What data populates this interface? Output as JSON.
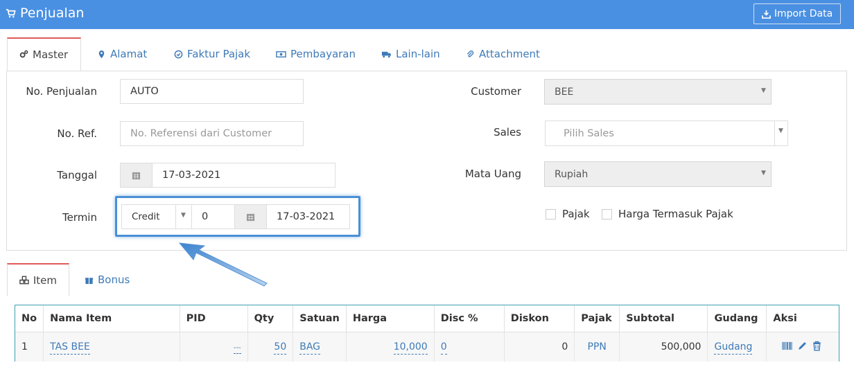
{
  "header": {
    "title": "Penjualan",
    "import_label": "Import Data",
    "bg_color": "#4a90e2"
  },
  "tabs": [
    {
      "label": "Master",
      "icon": "cogs-icon"
    },
    {
      "label": "Alamat",
      "icon": "map-marker-icon"
    },
    {
      "label": "Faktur Pajak",
      "icon": "check-circle-icon"
    },
    {
      "label": "Pembayaran",
      "icon": "money-icon"
    },
    {
      "label": "Lain-lain",
      "icon": "truck-icon"
    },
    {
      "label": "Attachment",
      "icon": "paperclip-icon"
    }
  ],
  "form": {
    "no_penjualan_label": "No. Penjualan",
    "no_penjualan_value": "AUTO",
    "no_ref_label": "No. Ref.",
    "no_ref_placeholder": "No. Referensi dari Customer",
    "tanggal_label": "Tanggal",
    "tanggal_value": "17-03-2021",
    "termin_label": "Termin",
    "termin_type": "Credit",
    "termin_days": "0",
    "termin_date": "17-03-2021",
    "customer_label": "Customer",
    "customer_value": "BEE",
    "sales_label": "Sales",
    "sales_placeholder": "Pilih Sales",
    "mata_uang_label": "Mata Uang",
    "mata_uang_value": "Rupiah",
    "pajak_label": "Pajak",
    "harga_termasuk_pajak_label": "Harga Termasuk Pajak"
  },
  "lower_tabs": [
    {
      "label": "Item",
      "icon": "cubes-icon"
    },
    {
      "label": "Bonus",
      "icon": "gift-icon"
    }
  ],
  "table": {
    "headers": [
      "No",
      "Nama Item",
      "PID",
      "Qty",
      "Satuan",
      "Harga",
      "Disc %",
      "Diskon",
      "Pajak",
      "Subtotal",
      "Gudang",
      "Aksi"
    ],
    "rows": [
      {
        "no": "1",
        "nama_item": "TAS BEE",
        "pid": "---",
        "qty": "50",
        "satuan": "BAG",
        "harga": "10,000",
        "disc": "0",
        "diskon": "0",
        "pajak": "PPN",
        "subtotal": "500,000",
        "gudang": "Gudang"
      }
    ]
  }
}
